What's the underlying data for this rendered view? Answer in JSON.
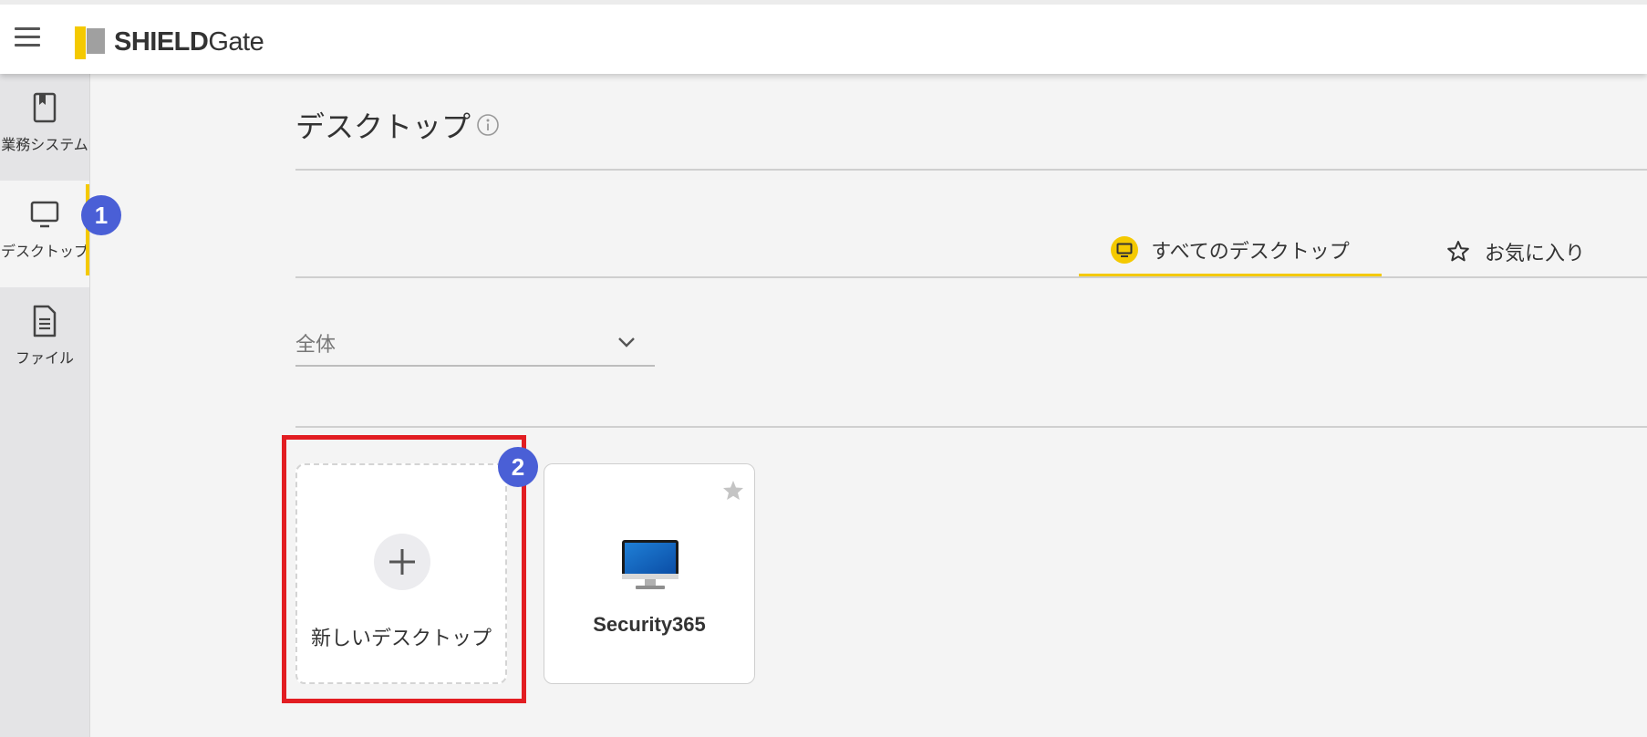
{
  "app": {
    "logo_bold": "SHIELD",
    "logo_light": "Gate"
  },
  "sidebar": {
    "items": [
      {
        "label": "業務システム",
        "icon": "bookmark-page-icon",
        "active": false
      },
      {
        "label": "デスクトップ",
        "icon": "monitor-icon",
        "active": true
      },
      {
        "label": "ファイル",
        "icon": "document-icon",
        "active": false
      }
    ]
  },
  "main": {
    "title": "デスクトップ",
    "tabs": [
      {
        "label": "すべてのデスクトップ",
        "icon": "desktop-circle-icon",
        "active": true
      },
      {
        "label": "お気に入り",
        "icon": "star-outline-icon",
        "active": false
      }
    ],
    "filter": {
      "selected": "全体"
    },
    "cards": [
      {
        "label": "新しいデスクトップ",
        "icon": "plus-icon",
        "kind": "new"
      },
      {
        "label": "Security365",
        "icon": "imac-monitor-icon",
        "kind": "desktop",
        "favorite": false
      }
    ]
  },
  "annotations": {
    "step1": "1",
    "step2": "2"
  },
  "colors": {
    "accent_yellow": "#f4c900",
    "badge_blue": "#4a5fd6",
    "highlight_red": "#e21d22",
    "sidebar_bg": "#e4e4e6",
    "page_bg": "#f4f4f4"
  }
}
